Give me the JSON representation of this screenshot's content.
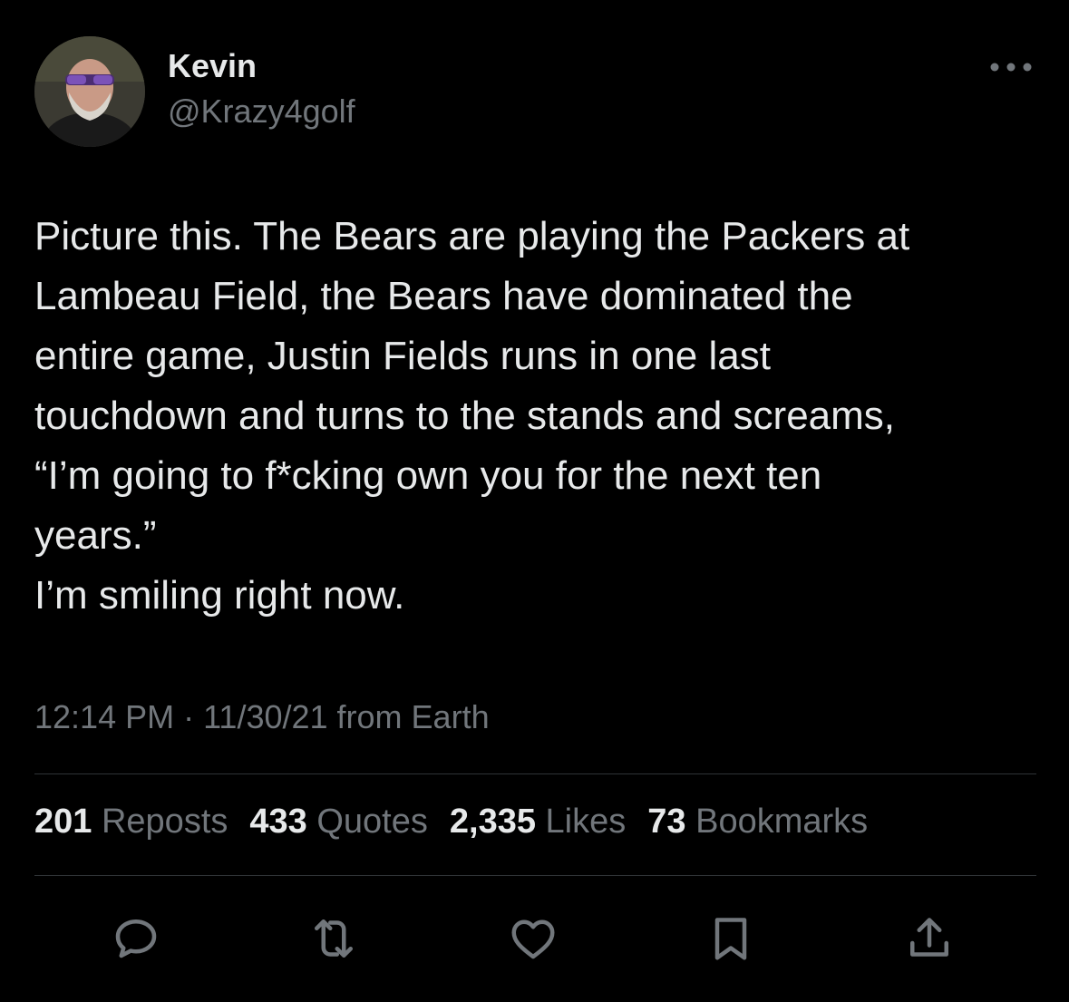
{
  "author": {
    "display_name": "Kevin",
    "handle": "@Krazy4golf",
    "avatar_icon": "profile-photo"
  },
  "tweet": {
    "text": "Picture this. The Bears are playing the Packers at\nLambeau Field, the Bears have dominated the\nentire game, Justin Fields runs in one last\ntouchdown and turns to the stands and screams,\n“I’m going to f*cking own you for the next ten\nyears.”\nI’m smiling right now.",
    "meta": "12:14 PM · 11/30/21 from Earth"
  },
  "stats": {
    "reposts_count": "201",
    "reposts_label": "Reposts",
    "quotes_count": "433",
    "quotes_label": "Quotes",
    "likes_count": "2,335",
    "likes_label": "Likes",
    "bookmarks_count": "73",
    "bookmarks_label": "Bookmarks"
  },
  "actions": [
    "reply-icon",
    "repost-icon",
    "like-icon",
    "bookmark-icon",
    "share-icon"
  ],
  "colors": {
    "background": "#000000",
    "primary_text": "#e7e9ea",
    "secondary_text": "#71767b",
    "divider": "#2f3336"
  }
}
